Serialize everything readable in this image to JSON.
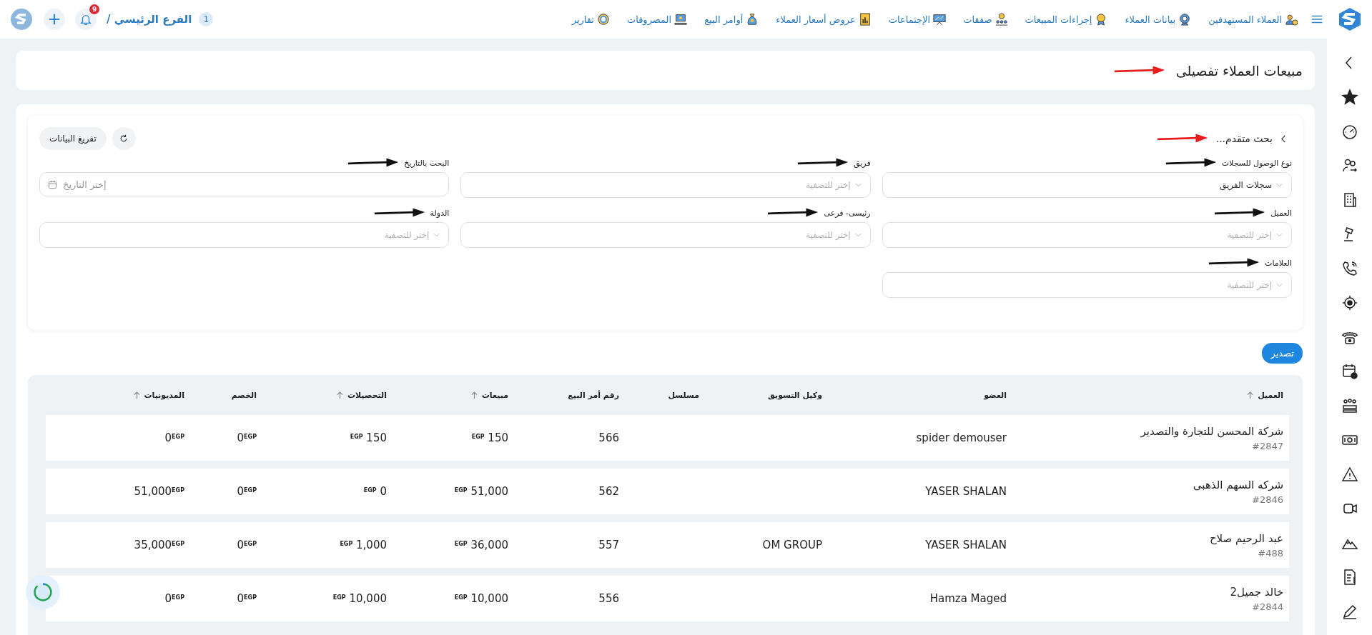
{
  "topbar": {
    "nav": [
      {
        "label": "العملاء المستهدفين"
      },
      {
        "label": "بيانات العملاء"
      },
      {
        "label": "إجراءات المبيعات"
      },
      {
        "label": "صفقات"
      },
      {
        "label": "الإجتماعات"
      },
      {
        "label": "عروض أسعار العملاء"
      },
      {
        "label": "أوامر البيع"
      },
      {
        "label": "المصروفات"
      },
      {
        "label": "تقارير"
      }
    ],
    "branch": {
      "count": "1",
      "label": "الفرع الرئيسي /"
    },
    "notifications": "9"
  },
  "page_title": "مبيعات العملاء تفصيلى",
  "filters": {
    "title": "بحث متقدم...",
    "buttons": [
      "تفريغ البيانات"
    ],
    "fields": [
      {
        "kind": "select",
        "label": "نوع الوصول للسجلات",
        "value": "سجلات الفريق"
      },
      {
        "kind": "select",
        "label": "فريق",
        "placeholder": "إختر للتصفية"
      },
      {
        "kind": "date",
        "label": "البحث بالتاريخ",
        "placeholder": "إختر التاريخ"
      },
      {
        "kind": "select",
        "label": "العميل",
        "placeholder": "إختر للتصفية"
      },
      {
        "kind": "select",
        "label": "رئيسى- فرعى",
        "placeholder": "إختر للتصفية"
      },
      {
        "kind": "select",
        "label": "الدولة",
        "placeholder": "إختر للتصفية"
      },
      {
        "kind": "select",
        "label": "العلامات",
        "placeholder": "إختر للتصفية"
      }
    ]
  },
  "export_button": "تصدير",
  "table": {
    "columns": [
      {
        "label": "العميل",
        "sortable": true
      },
      {
        "label": "العضو",
        "sortable": false
      },
      {
        "label": "وكيل التسويق",
        "sortable": false
      },
      {
        "label": "مسلسل",
        "sortable": false
      },
      {
        "label": "رقم أمر البيع",
        "sortable": false
      },
      {
        "label": "مبيعات",
        "sortable": true
      },
      {
        "label": "التحصيلات",
        "sortable": true
      },
      {
        "label": "الخصم",
        "sortable": false
      },
      {
        "label": "المديونيات",
        "sortable": true
      }
    ],
    "rows": [
      {
        "client": "شركة المحسن للتجارة والتصدير",
        "client_id": "#2847",
        "member": "spider demouser",
        "order": "566",
        "sales": {
          "currency": "EGP",
          "amount": "150"
        },
        "collections": {
          "currency": "EGP",
          "amount": "150"
        },
        "discount": {
          "amount": "0",
          "currency": "EGP"
        },
        "debts": {
          "amount": "0",
          "currency": "EGP"
        }
      },
      {
        "client": "شركه السهم الذهبى",
        "client_id": "#2846",
        "member": "YASER SHALAN",
        "order": "562",
        "sales": {
          "currency": "EGP",
          "amount": "51,000"
        },
        "collections": {
          "currency": "EGP",
          "amount": "0"
        },
        "discount": {
          "amount": "0",
          "currency": "EGP"
        },
        "debts": {
          "amount": "51,000",
          "currency": "EGP"
        }
      },
      {
        "client": "عبد الرحيم صلاح",
        "client_id": "#488",
        "member": "YASER SHALAN",
        "agent": "OM GROUP",
        "order": "557",
        "sales": {
          "currency": "EGP",
          "amount": "36,000"
        },
        "collections": {
          "currency": "EGP",
          "amount": "1,000"
        },
        "discount": {
          "amount": "0",
          "currency": "EGP"
        },
        "debts": {
          "amount": "35,000",
          "currency": "EGP"
        }
      },
      {
        "client": "خالد جميل2",
        "client_id": "#2844",
        "member": "Hamza Maged",
        "order": "556",
        "sales": {
          "currency": "EGP",
          "amount": "10,000"
        },
        "collections": {
          "currency": "EGP",
          "amount": "10,000"
        },
        "discount": {
          "amount": "0",
          "currency": "EGP"
        },
        "debts": {
          "amount": "0",
          "currency": "EGP"
        }
      }
    ]
  }
}
